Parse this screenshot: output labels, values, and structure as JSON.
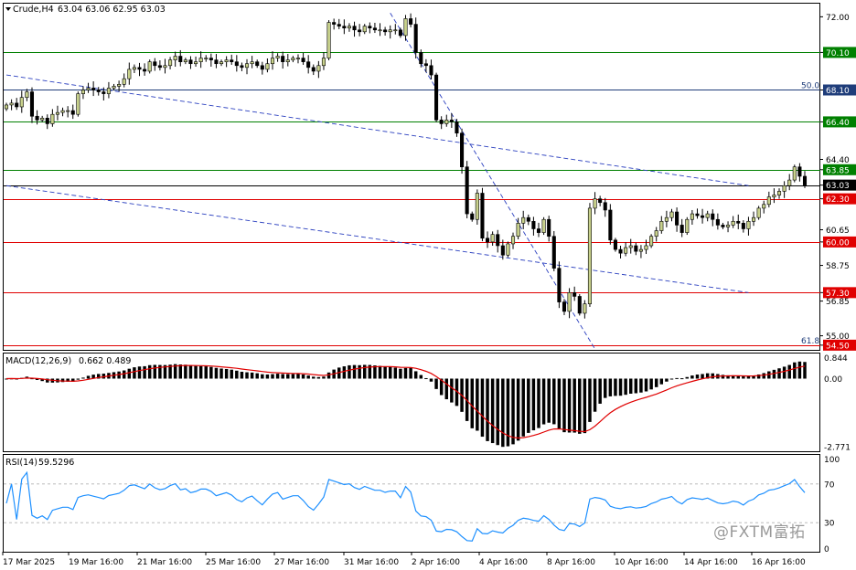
{
  "header": {
    "symbol_label": "Crude,H4",
    "ohlc_text": "63.04 63.06 62.95 63.03"
  },
  "watermark": "@FXTM富拓",
  "chart_data": {
    "type": "candlestick",
    "symbol": "Crude",
    "timeframe": "H4",
    "current_price": 63.03,
    "price_axis": {
      "range": [
        54.25,
        72.7
      ],
      "ticks": [
        72.0,
        70.1,
        68.1,
        66.4,
        64.4,
        63.85,
        63.03,
        62.3,
        60.65,
        60.0,
        58.75,
        57.3,
        56.85,
        55.0,
        54.5
      ]
    },
    "horizontal_levels": [
      {
        "price": 70.1,
        "label": "70.10",
        "color": "#008000"
      },
      {
        "price": 68.1,
        "label": "68.10",
        "color": "#1f3d7a"
      },
      {
        "price": 66.4,
        "label": "66.40",
        "color": "#008000"
      },
      {
        "price": 63.85,
        "label": "63.85",
        "color": "#008000"
      },
      {
        "price": 63.03,
        "label": "63.03",
        "color": "#000000"
      },
      {
        "price": 62.3,
        "label": "62.30",
        "color": "#e00000"
      },
      {
        "price": 60.0,
        "label": "60.00",
        "color": "#e00000"
      },
      {
        "price": 57.3,
        "label": "57.30",
        "color": "#e00000"
      },
      {
        "price": 54.5,
        "label": "54.50",
        "color": "#e00000"
      }
    ],
    "fib_labels": [
      {
        "text": "50.0",
        "price": 68.1
      },
      {
        "text": "61.8",
        "price": 54.5
      }
    ],
    "trendlines": [
      {
        "from": [
          0,
          68.9
        ],
        "to": [
          145,
          63.0
        ]
      },
      {
        "from": [
          0,
          63.0
        ],
        "to": [
          145,
          57.3
        ]
      },
      {
        "from": [
          75,
          72.2
        ],
        "to": [
          115,
          54.3
        ]
      }
    ],
    "time_labels": [
      "17 Mar 2025",
      "19 Mar 16:00",
      "21 Mar 16:00",
      "25 Mar 16:00",
      "27 Mar 16:00",
      "31 Mar 16:00",
      "2 Apr 16:00",
      "4 Apr 16:00",
      "8 Apr 16:00",
      "10 Apr 16:00",
      "14 Apr 16:00",
      "16 Apr 16:00"
    ],
    "close": [
      67.3,
      67.4,
      67.2,
      67.7,
      68.0,
      66.7,
      66.5,
      66.6,
      66.3,
      66.8,
      66.9,
      67.0,
      67.0,
      66.8,
      67.9,
      68.1,
      68.2,
      68.1,
      68.0,
      67.9,
      68.2,
      68.3,
      68.4,
      68.7,
      69.2,
      69.3,
      69.2,
      69.1,
      69.6,
      69.4,
      69.3,
      69.4,
      69.7,
      69.9,
      69.6,
      69.7,
      69.5,
      69.6,
      69.8,
      69.8,
      69.7,
      69.5,
      69.6,
      69.7,
      69.6,
      69.4,
      69.3,
      69.5,
      69.6,
      69.4,
      69.2,
      69.5,
      69.8,
      69.9,
      69.6,
      69.7,
      69.8,
      69.8,
      69.6,
      69.3,
      69.1,
      69.4,
      69.8,
      71.7,
      71.6,
      71.5,
      71.4,
      71.5,
      71.3,
      71.2,
      71.5,
      71.4,
      71.3,
      71.3,
      71.2,
      71.3,
      71.3,
      71.0,
      71.9,
      71.6,
      70.1,
      69.5,
      69.4,
      68.9,
      66.5,
      66.3,
      66.5,
      66.4,
      65.8,
      64.0,
      61.5,
      61.2,
      62.6,
      60.2,
      60.0,
      60.4,
      59.8,
      59.3,
      59.9,
      60.3,
      61.0,
      61.3,
      61.1,
      60.7,
      60.5,
      61.2,
      60.3,
      58.6,
      56.8,
      56.3,
      57.3,
      57.1,
      56.2,
      56.7,
      61.8,
      62.3,
      62.1,
      61.7,
      60.1,
      59.6,
      59.4,
      59.7,
      59.8,
      59.5,
      59.6,
      59.8,
      60.3,
      60.6,
      61.1,
      61.3,
      61.6,
      60.9,
      60.5,
      61.2,
      61.5,
      61.4,
      61.3,
      61.5,
      61.2,
      60.9,
      60.8,
      60.9,
      61.1,
      61.0,
      60.7,
      61.1,
      61.3,
      61.8,
      62.0,
      62.4,
      62.5,
      62.7,
      63.0,
      63.3,
      64.0,
      63.5,
      63.03
    ],
    "indicators": [
      {
        "name": "MACD(12,26,9)",
        "values_text": "0.662 0.489",
        "ticks": [
          0.844,
          0.0,
          -2.771
        ],
        "range": [
          -2.95,
          1.02
        ],
        "histogram_color": "#000000",
        "signal_color": "#e00000"
      },
      {
        "name": "RSI(14)",
        "values_text": "59.5296",
        "ticks": [
          100,
          70,
          30,
          0
        ],
        "range": [
          0,
          100
        ],
        "levels": [
          70,
          30
        ],
        "line_color": "#1e90ff"
      }
    ],
    "colors": {
      "bull_body": "#c8d18c",
      "bear_body": "#000000",
      "wick": "#000000",
      "trendline": "#2a3fbf",
      "price_box": "#000000"
    }
  }
}
